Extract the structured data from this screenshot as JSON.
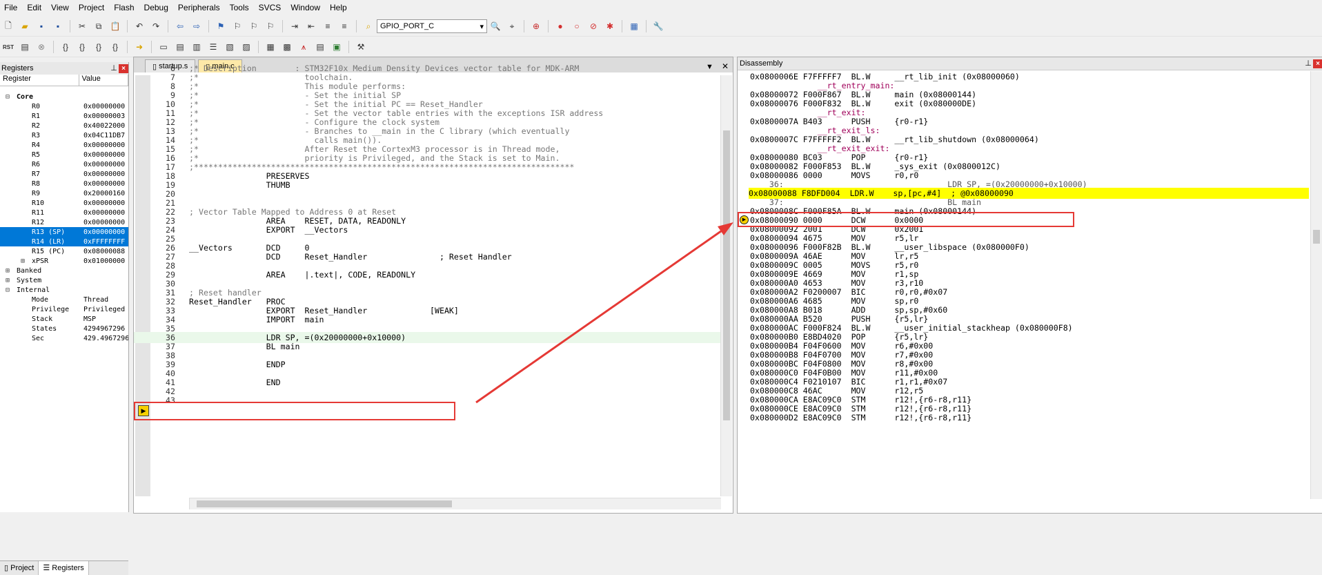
{
  "menu": [
    "File",
    "Edit",
    "View",
    "Project",
    "Flash",
    "Debug",
    "Peripherals",
    "Tools",
    "SVCS",
    "Window",
    "Help"
  ],
  "toolbar": {
    "target_combo": "GPIO_PORT_C",
    "rst_label": "RST"
  },
  "registers": {
    "title": "Registers",
    "col_register": "Register",
    "col_value": "Value",
    "rows": [
      {
        "name": "Core",
        "value": ""
      },
      {
        "name": "R0",
        "value": "0x00000000"
      },
      {
        "name": "R1",
        "value": "0x00000003"
      },
      {
        "name": "R2",
        "value": "0x40022000"
      },
      {
        "name": "R3",
        "value": "0x04C11DB7"
      },
      {
        "name": "R4",
        "value": "0x00000000"
      },
      {
        "name": "R5",
        "value": "0x00000000"
      },
      {
        "name": "R6",
        "value": "0x00000000"
      },
      {
        "name": "R7",
        "value": "0x00000000"
      },
      {
        "name": "R8",
        "value": "0x00000000"
      },
      {
        "name": "R9",
        "value": "0x20000160"
      },
      {
        "name": "R10",
        "value": "0x00000000"
      },
      {
        "name": "R11",
        "value": "0x00000000"
      },
      {
        "name": "R12",
        "value": "0x00000000"
      },
      {
        "name": "R13 (SP)",
        "value": "0x00000000"
      },
      {
        "name": "R14 (LR)",
        "value": "0xFFFFFFFF"
      },
      {
        "name": "R15 (PC)",
        "value": "0x08000088"
      },
      {
        "name": "xPSR",
        "value": "0x01000000"
      },
      {
        "name": "Banked",
        "value": ""
      },
      {
        "name": "System",
        "value": ""
      },
      {
        "name": "Internal",
        "value": ""
      },
      {
        "name": "Mode",
        "value": "Thread"
      },
      {
        "name": "Privilege",
        "value": "Privileged"
      },
      {
        "name": "Stack",
        "value": "MSP"
      },
      {
        "name": "States",
        "value": "4294967296"
      },
      {
        "name": "Sec",
        "value": "429.4967296"
      }
    ],
    "bottom_tabs": [
      "Project",
      "Registers"
    ]
  },
  "editor": {
    "tabs": [
      "startup.s",
      "main.c"
    ],
    "lines": [
      {
        "n": "6",
        "t": ";* Description        : STM32F10x Medium Density Devices vector table for MDK-ARM"
      },
      {
        "n": "7",
        "t": ";*                      toolchain."
      },
      {
        "n": "8",
        "t": ";*                      This module performs:"
      },
      {
        "n": "9",
        "t": ";*                      - Set the initial SP"
      },
      {
        "n": "10",
        "t": ";*                      - Set the initial PC == Reset_Handler"
      },
      {
        "n": "11",
        "t": ";*                      - Set the vector table entries with the exceptions ISR address"
      },
      {
        "n": "12",
        "t": ";*                      - Configure the clock system"
      },
      {
        "n": "13",
        "t": ";*                      - Branches to __main in the C library (which eventually"
      },
      {
        "n": "14",
        "t": ";*                        calls main())."
      },
      {
        "n": "15",
        "t": ";*                      After Reset the CortexM3 processor is in Thread mode,"
      },
      {
        "n": "16",
        "t": ";*                      priority is Privileged, and the Stack is set to Main."
      },
      {
        "n": "17",
        "t": ";*******************************************************************************"
      },
      {
        "n": "18",
        "t": "                PRESERVES"
      },
      {
        "n": "19",
        "t": "                THUMB"
      },
      {
        "n": "20",
        "t": ""
      },
      {
        "n": "21",
        "t": ""
      },
      {
        "n": "22",
        "t": "; Vector Table Mapped to Address 0 at Reset"
      },
      {
        "n": "23",
        "t": "                AREA    RESET, DATA, READONLY"
      },
      {
        "n": "24",
        "t": "                EXPORT  __Vectors"
      },
      {
        "n": "25",
        "t": ""
      },
      {
        "n": "26",
        "t": "__Vectors       DCD     0"
      },
      {
        "n": "27",
        "t": "                DCD     Reset_Handler               ; Reset Handler"
      },
      {
        "n": "28",
        "t": ""
      },
      {
        "n": "29",
        "t": "                AREA    |.text|, CODE, READONLY"
      },
      {
        "n": "30",
        "t": ""
      },
      {
        "n": "31",
        "t": "; Reset handler"
      },
      {
        "n": "32",
        "t": "Reset_Handler   PROC"
      },
      {
        "n": "33",
        "t": "                EXPORT  Reset_Handler             [WEAK]"
      },
      {
        "n": "34",
        "t": "                IMPORT  main"
      },
      {
        "n": "35",
        "t": ""
      },
      {
        "n": "36",
        "t": "                LDR SP, =(0x20000000+0x10000)"
      },
      {
        "n": "37",
        "t": "                BL main"
      },
      {
        "n": "38",
        "t": ""
      },
      {
        "n": "39",
        "t": "                ENDP"
      },
      {
        "n": "40",
        "t": ""
      },
      {
        "n": "41",
        "t": "                END"
      },
      {
        "n": "42",
        "t": ""
      },
      {
        "n": "43",
        "t": ""
      }
    ]
  },
  "disassembly": {
    "title": "Disassembly",
    "lines": [
      {
        "k": "i",
        "t": "0x0800006E F7FFFFF7  BL.W     __rt_lib_init (0x08000060)"
      },
      {
        "k": "l",
        "t": "              __rt_entry_main:"
      },
      {
        "k": "i",
        "t": "0x08000072 F000F867  BL.W     main (0x08000144)"
      },
      {
        "k": "i",
        "t": "0x08000076 F000F832  BL.W     exit (0x080000DE)"
      },
      {
        "k": "l",
        "t": "              __rt_exit:"
      },
      {
        "k": "i",
        "t": "0x0800007A B403      PUSH     {r0-r1}"
      },
      {
        "k": "l",
        "t": "              __rt_exit_ls:"
      },
      {
        "k": "i",
        "t": "0x0800007C F7FFFFF2  BL.W     __rt_lib_shutdown (0x08000064)"
      },
      {
        "k": "l",
        "t": "              __rt_exit_exit:"
      },
      {
        "k": "i",
        "t": "0x08000080 BC03      POP      {r0-r1}"
      },
      {
        "k": "i",
        "t": "0x08000082 F000F853  BL.W     _sys_exit (0x0800012C)"
      },
      {
        "k": "i",
        "t": "0x08000086 0000      MOVS     r0,r0"
      },
      {
        "k": "s",
        "t": "    36:                                  LDR SP, =(0x20000000+0x10000)"
      },
      {
        "k": "c",
        "t": "0x08000088 F8DFD004  LDR.W    sp,[pc,#4]  ; @0x08000090"
      },
      {
        "k": "s",
        "t": "    37:                                  BL main"
      },
      {
        "k": "i",
        "t": "0x0800008C F000F85A  BL.W     main (0x08000144)"
      },
      {
        "k": "i",
        "t": "0x08000090 0000      DCW      0x0000"
      },
      {
        "k": "i",
        "t": "0x08000092 2001      DCW      0x2001"
      },
      {
        "k": "i",
        "t": "0x08000094 4675      MOV      r5,lr"
      },
      {
        "k": "i",
        "t": "0x08000096 F000F82B  BL.W     __user_libspace (0x080000F0)"
      },
      {
        "k": "i",
        "t": "0x0800009A 46AE      MOV      lr,r5"
      },
      {
        "k": "i",
        "t": "0x0800009C 0005      MOVS     r5,r0"
      },
      {
        "k": "i",
        "t": "0x0800009E 4669      MOV      r1,sp"
      },
      {
        "k": "i",
        "t": "0x080000A0 4653      MOV      r3,r10"
      },
      {
        "k": "i",
        "t": "0x080000A2 F0200007  BIC      r0,r0,#0x07"
      },
      {
        "k": "i",
        "t": "0x080000A6 4685      MOV      sp,r0"
      },
      {
        "k": "i",
        "t": "0x080000A8 B018      ADD      sp,sp,#0x60"
      },
      {
        "k": "i",
        "t": "0x080000AA B520      PUSH     {r5,lr}"
      },
      {
        "k": "i",
        "t": "0x080000AC F000F824  BL.W     __user_initial_stackheap (0x080000F8)"
      },
      {
        "k": "i",
        "t": "0x080000B0 E8BD4020  POP      {r5,lr}"
      },
      {
        "k": "i",
        "t": "0x080000B4 F04F0600  MOV      r6,#0x00"
      },
      {
        "k": "i",
        "t": "0x080000B8 F04F0700  MOV      r7,#0x00"
      },
      {
        "k": "i",
        "t": "0x080000BC F04F0800  MOV      r8,#0x00"
      },
      {
        "k": "i",
        "t": "0x080000C0 F04F0B00  MOV      r11,#0x00"
      },
      {
        "k": "i",
        "t": "0x080000C4 F0210107  BIC      r1,r1,#0x07"
      },
      {
        "k": "i",
        "t": "0x080000C8 46AC      MOV      r12,r5"
      },
      {
        "k": "i",
        "t": "0x080000CA E8AC09C0  STM      r12!,{r6-r8,r11}"
      },
      {
        "k": "i",
        "t": "0x080000CE E8AC09C0  STM      r12!,{r6-r8,r11}"
      },
      {
        "k": "i",
        "t": "0x080000D2 E8AC09C0  STM      r12!,{r6-r8,r11}"
      }
    ]
  }
}
